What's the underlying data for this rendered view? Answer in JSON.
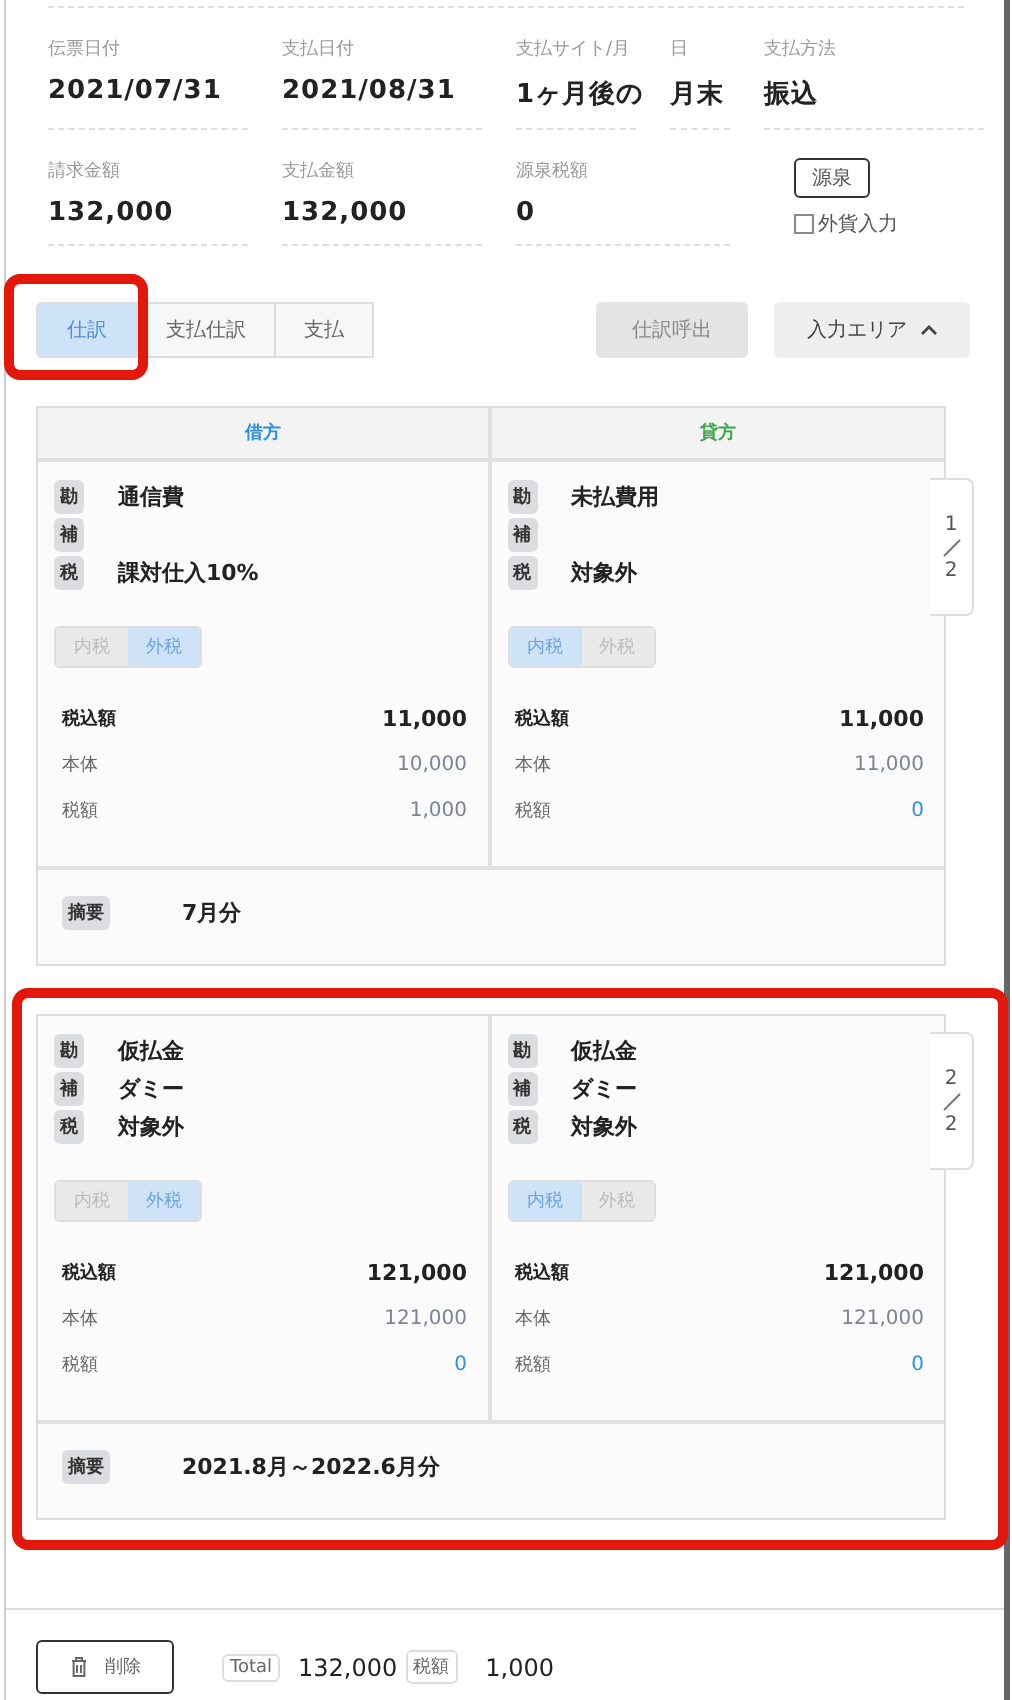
{
  "fields": [
    {
      "label": "伝票日付",
      "value": "2021/07/31"
    },
    {
      "label": "支払日付",
      "value": "2021/08/31"
    },
    {
      "label": "支払サイト/月",
      "value": "1ヶ月後の"
    },
    {
      "label": "日",
      "value": "月末"
    },
    {
      "label": "支払方法",
      "value": "振込"
    },
    {
      "label": "請求金額",
      "value": "132,000"
    },
    {
      "label": "支払金額",
      "value": "132,000"
    },
    {
      "label": "源泉税額",
      "value": "0"
    }
  ],
  "withholding_button": "源泉",
  "foreign_currency": {
    "label": "外貨入力",
    "checked": false
  },
  "tabs": [
    {
      "label": "仕訳",
      "selected": true,
      "highlighted": true
    },
    {
      "label": "支払仕訳",
      "selected": false,
      "highlighted": false
    },
    {
      "label": "支払",
      "selected": false,
      "highlighted": false
    }
  ],
  "recall_button": {
    "label": "仕訳呼出",
    "disabled": true
  },
  "input_area_button": "入力エリア",
  "columns": [
    {
      "label": "借方",
      "color": "#2f8fe0"
    },
    {
      "label": "貸方",
      "color": "#3aa845"
    }
  ],
  "entries": [
    {
      "highlighted": false,
      "page": "1",
      "pages": "2",
      "sides": [
        {
          "rows": [
            {
              "label": "勘",
              "value": "通信費"
            },
            {
              "label": "補"
            },
            {
              "label": "税",
              "value": "課対仕入10%"
            }
          ],
          "toggle": [
            {
              "label": "内税",
              "selected": false
            },
            {
              "label": "外税",
              "selected": true
            }
          ],
          "amounts": [
            {
              "kind": "total",
              "label": "税込額",
              "value": "11,000"
            },
            {
              "kind": "sub",
              "label": "本体",
              "value": "10,000"
            },
            {
              "kind": "sub",
              "label": "税額",
              "value": "1,000"
            }
          ]
        },
        {
          "rows": [
            {
              "label": "勘",
              "value": "未払費用"
            },
            {
              "label": "補"
            },
            {
              "label": "税",
              "value": "対象外"
            }
          ],
          "toggle": [
            {
              "label": "内税",
              "selected": true
            },
            {
              "label": "外税",
              "selected": false
            }
          ],
          "amounts": [
            {
              "kind": "total",
              "label": "税込額",
              "value": "11,000"
            },
            {
              "kind": "sub",
              "label": "本体",
              "value": "11,000"
            },
            {
              "kind": "zero",
              "label": "税額",
              "value": "0"
            }
          ]
        }
      ],
      "summary": {
        "label": "摘要",
        "value": "7月分"
      }
    },
    {
      "highlighted": true,
      "page": "2",
      "pages": "2",
      "sides": [
        {
          "rows": [
            {
              "label": "勘",
              "value": "仮払金"
            },
            {
              "label": "補",
              "value": "ダミー"
            },
            {
              "label": "税",
              "value": "対象外"
            }
          ],
          "toggle": [
            {
              "label": "内税",
              "selected": false
            },
            {
              "label": "外税",
              "selected": true
            }
          ],
          "amounts": [
            {
              "kind": "total",
              "label": "税込額",
              "value": "121,000"
            },
            {
              "kind": "sub",
              "label": "本体",
              "value": "121,000"
            },
            {
              "kind": "zero",
              "label": "税額",
              "value": "0"
            }
          ]
        },
        {
          "rows": [
            {
              "label": "勘",
              "value": "仮払金"
            },
            {
              "label": "補",
              "value": "ダミー"
            },
            {
              "label": "税",
              "value": "対象外"
            }
          ],
          "toggle": [
            {
              "label": "内税",
              "selected": true
            },
            {
              "label": "外税",
              "selected": false
            }
          ],
          "amounts": [
            {
              "kind": "total",
              "label": "税込額",
              "value": "121,000"
            },
            {
              "kind": "sub",
              "label": "本体",
              "value": "121,000"
            },
            {
              "kind": "zero",
              "label": "税額",
              "value": "0"
            }
          ]
        }
      ],
      "summary": {
        "label": "摘要",
        "value": "2021.8月～2022.6月分"
      }
    }
  ],
  "footer": {
    "delete_button": "削除",
    "total_label": "Total",
    "total": "132,000",
    "tax_label": "税額",
    "tax": "1,000"
  }
}
